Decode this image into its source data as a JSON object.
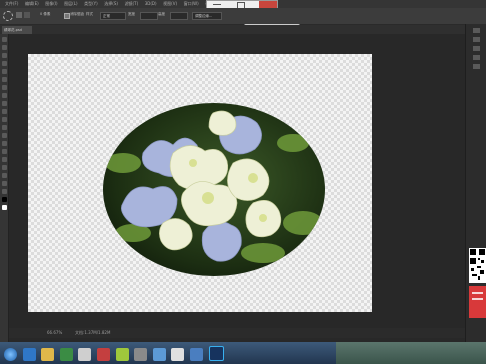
{
  "app": {
    "menu_items": [
      "文件(F)",
      "编辑(E)",
      "图像(I)",
      "图层(L)",
      "类型(Y)",
      "选择(S)",
      "滤镜(T)",
      "3D(D)",
      "视图(V)",
      "窗口(W)",
      "帮助(H)"
    ]
  },
  "options_bar": {
    "feather_value": "0 像素",
    "anti_alias_label": "消除锯齿",
    "style_label": "样式",
    "style_value": "正常",
    "width_label": "宽度",
    "height_label": "高度",
    "refine_edge_label": "调整边缘..."
  },
  "document": {
    "tab_label": "绣球花.psd"
  },
  "status_bar": {
    "zoom": "66.67%",
    "doc_info": "文档:1.37M/1.82M"
  },
  "colors": {
    "ui_dark": "#282828",
    "panel": "#3c3c3c",
    "accent_red": "#d8393a"
  }
}
